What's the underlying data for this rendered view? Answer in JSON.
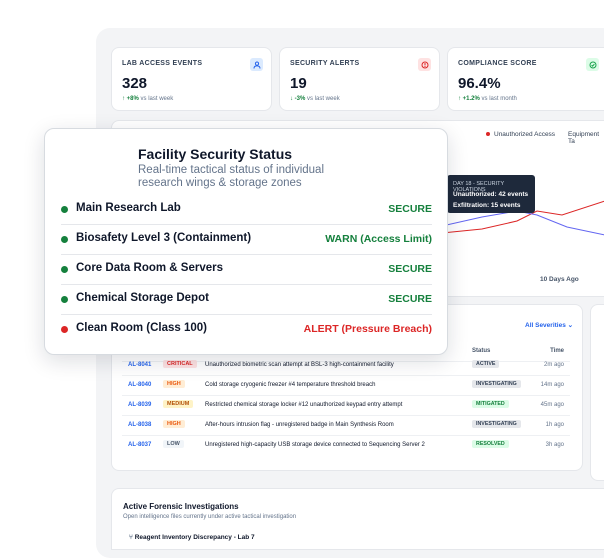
{
  "kpis": [
    {
      "label": "LAB ACCESS EVENTS",
      "value": "328",
      "delta": "+8%",
      "delta_note": "vs last week",
      "icon": "user-icon",
      "icon_color": "#2563eb",
      "icon_bg": "#dbeafe"
    },
    {
      "label": "SECURITY ALERTS",
      "value": "19",
      "delta": "-3%",
      "delta_note": "vs last week",
      "icon": "alert-icon",
      "icon_color": "#dc2626",
      "icon_bg": "#fee2e2"
    },
    {
      "label": "COMPLIANCE SCORE",
      "value": "96.4%",
      "delta": "+1.2%",
      "delta_note": "vs last month",
      "icon": "check-circle-icon",
      "icon_color": "#16a34a",
      "icon_bg": "#dcfce7"
    }
  ],
  "chart": {
    "legend": [
      "Unauthorized Access",
      "Equipment Ta"
    ],
    "tooltip": {
      "title": "DAY 18 - SECURITY VIOLATIONS",
      "line1": "Unauthorized: 42 events",
      "line2": "Exfiltration: 15 events"
    },
    "x_label": "10 Days Ago"
  },
  "incidents": {
    "filter": "All Severities",
    "headers": {
      "status": "Status",
      "time": "Time"
    },
    "rows": [
      {
        "id": "AL-8041",
        "severity": "CRITICAL",
        "desc": "Unauthorized biometric scan attempt at BSL-3 high-containment facility",
        "status": "ACTIVE",
        "time": "2m ago"
      },
      {
        "id": "AL-8040",
        "severity": "HIGH",
        "desc": "Cold storage cryogenic freezer #4 temperature threshold breach",
        "status": "INVESTIGATING",
        "time": "14m ago"
      },
      {
        "id": "AL-8039",
        "severity": "MEDIUM",
        "desc": "Restricted chemical storage locker #12 unauthorized keypad entry attempt",
        "status": "MITIGATED",
        "time": "45m ago"
      },
      {
        "id": "AL-8038",
        "severity": "HIGH",
        "desc": "After-hours intrusion flag - unregistered badge in Main Synthesis Room",
        "status": "INVESTIGATING",
        "time": "1h ago"
      },
      {
        "id": "AL-8037",
        "severity": "LOW",
        "desc": "Unregistered high-capacity USB storage device connected to Sequencing Server 2",
        "status": "RESOLVED",
        "time": "3h ago"
      }
    ]
  },
  "forensics": {
    "title": "Active Forensic Investigations",
    "subtitle": "Open intelligence files currently under active tactical investigation",
    "first_item": "Reagent Inventory Discrepancy - Lab 7"
  },
  "panel": {
    "title": "Facility Security Status",
    "subtitle": "Real-time tactical status of individual research wings & storage zones",
    "zones": [
      {
        "name": "Main Research Lab",
        "status": "SECURE",
        "color": "#15803d"
      },
      {
        "name": "Biosafety Level 3 (Containment)",
        "status": "WARN (Access Limit)",
        "color": "#15803d"
      },
      {
        "name": "Core Data Room & Servers",
        "status": "SECURE",
        "color": "#15803d"
      },
      {
        "name": "Chemical Storage Depot",
        "status": "SECURE",
        "color": "#15803d"
      },
      {
        "name": "Clean Room (Class 100)",
        "status": "ALERT (Pressure Breach)",
        "color": "#dc2626"
      }
    ]
  }
}
